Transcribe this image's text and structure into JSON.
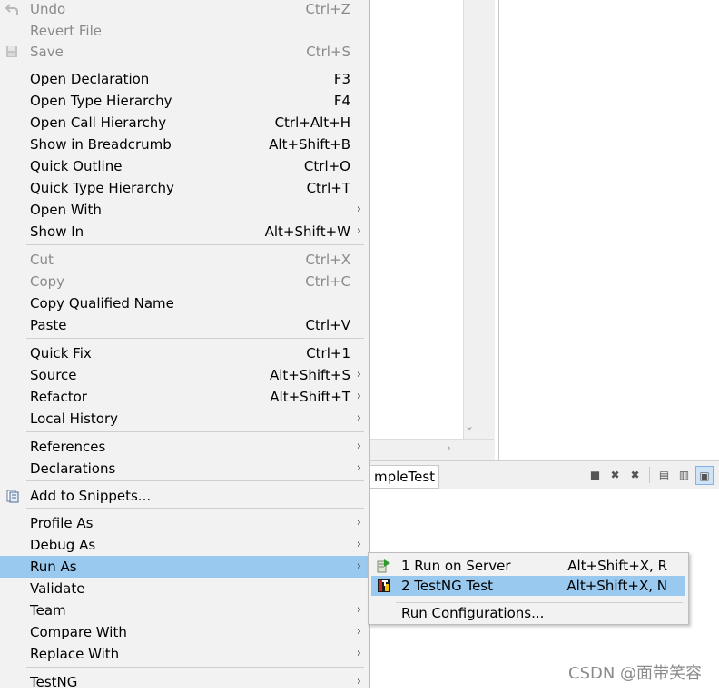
{
  "background": {
    "editor_tab_label": "mpleTest"
  },
  "menu": {
    "items": [
      {
        "label": "Undo",
        "shortcut": "Ctrl+Z",
        "disabled": true,
        "icon": "undo-icon"
      },
      {
        "label": "Revert File",
        "shortcut": "",
        "disabled": true
      },
      {
        "label": "Save",
        "shortcut": "Ctrl+S",
        "disabled": true,
        "icon": "save-icon"
      },
      {
        "label": "Open Declaration",
        "shortcut": "F3"
      },
      {
        "label": "Open Type Hierarchy",
        "shortcut": "F4"
      },
      {
        "label": "Open Call Hierarchy",
        "shortcut": "Ctrl+Alt+H"
      },
      {
        "label": "Show in Breadcrumb",
        "shortcut": "Alt+Shift+B"
      },
      {
        "label": "Quick Outline",
        "shortcut": "Ctrl+O"
      },
      {
        "label": "Quick Type Hierarchy",
        "shortcut": "Ctrl+T"
      },
      {
        "label": "Open With",
        "shortcut": "",
        "submenu": true
      },
      {
        "label": "Show In",
        "shortcut": "Alt+Shift+W",
        "submenu": true
      },
      {
        "label": "Cut",
        "shortcut": "Ctrl+X",
        "disabled": true
      },
      {
        "label": "Copy",
        "shortcut": "Ctrl+C",
        "disabled": true
      },
      {
        "label": "Copy Qualified Name",
        "shortcut": ""
      },
      {
        "label": "Paste",
        "shortcut": "Ctrl+V"
      },
      {
        "label": "Quick Fix",
        "shortcut": "Ctrl+1"
      },
      {
        "label": "Source",
        "shortcut": "Alt+Shift+S",
        "submenu": true
      },
      {
        "label": "Refactor",
        "shortcut": "Alt+Shift+T",
        "submenu": true
      },
      {
        "label": "Local History",
        "shortcut": "",
        "submenu": true
      },
      {
        "label": "References",
        "shortcut": "",
        "submenu": true
      },
      {
        "label": "Declarations",
        "shortcut": "",
        "submenu": true
      },
      {
        "label": "Add to Snippets...",
        "shortcut": "",
        "icon": "snippets-icon"
      },
      {
        "label": "Profile As",
        "shortcut": "",
        "submenu": true
      },
      {
        "label": "Debug As",
        "shortcut": "",
        "submenu": true
      },
      {
        "label": "Run As",
        "shortcut": "",
        "submenu": true,
        "highlighted": true
      },
      {
        "label": "Validate",
        "shortcut": ""
      },
      {
        "label": "Team",
        "shortcut": "",
        "submenu": true
      },
      {
        "label": "Compare With",
        "shortcut": "",
        "submenu": true
      },
      {
        "label": "Replace With",
        "shortcut": "",
        "submenu": true
      },
      {
        "label": "TestNG",
        "shortcut": "",
        "submenu": true
      }
    ]
  },
  "submenu": {
    "items": [
      {
        "label": "1 Run on Server",
        "shortcut": "Alt+Shift+X, R",
        "icon": "run-on-server-icon"
      },
      {
        "label": "2 TestNG Test",
        "shortcut": "Alt+Shift+X, N",
        "icon": "testng-icon",
        "highlighted": true
      },
      {
        "label": "Run Configurations...",
        "shortcut": ""
      }
    ]
  },
  "watermark": {
    "text": "CSDN @面带笑容"
  },
  "colors": {
    "highlight": "#99c9ef",
    "menu_bg": "#f2f2f2",
    "disabled_text": "#8a8a8a"
  }
}
